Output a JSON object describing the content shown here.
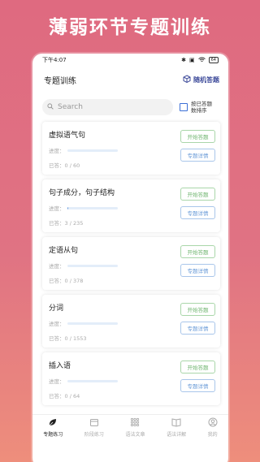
{
  "banner": "薄弱环节专题训练",
  "status": {
    "time": "下午4:07",
    "battery": "64"
  },
  "header": {
    "title": "专题训练",
    "random_label": "随机答题"
  },
  "search": {
    "placeholder": "Search"
  },
  "sort": {
    "label": "按已答题数排序"
  },
  "labels": {
    "progress": "进度：",
    "start": "开始答题",
    "detail": "专题详情"
  },
  "cards": [
    {
      "title": "虚拟语气句",
      "answered": "已答：0 / 60",
      "progress": 0.0
    },
    {
      "title": "句子成分，句子结构",
      "answered": "已答：3 / 235",
      "progress": 0.013
    },
    {
      "title": "定语从句",
      "answered": "已答：0 / 378",
      "progress": 0.0
    },
    {
      "title": "分词",
      "answered": "已答：0 / 1553",
      "progress": 0.0
    },
    {
      "title": "插入语",
      "answered": "已答：0 / 64",
      "progress": 0.0
    }
  ],
  "tabs": [
    {
      "label": "专题练习",
      "icon": "leaf-icon",
      "active": true
    },
    {
      "label": "阶段练习",
      "icon": "folder-icon",
      "active": false
    },
    {
      "label": "语法文章",
      "icon": "grid-icon",
      "active": false
    },
    {
      "label": "语法详解",
      "icon": "book-icon",
      "active": false
    },
    {
      "label": "我的",
      "icon": "user-icon",
      "active": false
    }
  ],
  "colors": {
    "accent": "#3d4a9a",
    "start_green": "#6fb56f",
    "detail_blue": "#6b9cd8",
    "checkbox": "#3b6fd6"
  }
}
